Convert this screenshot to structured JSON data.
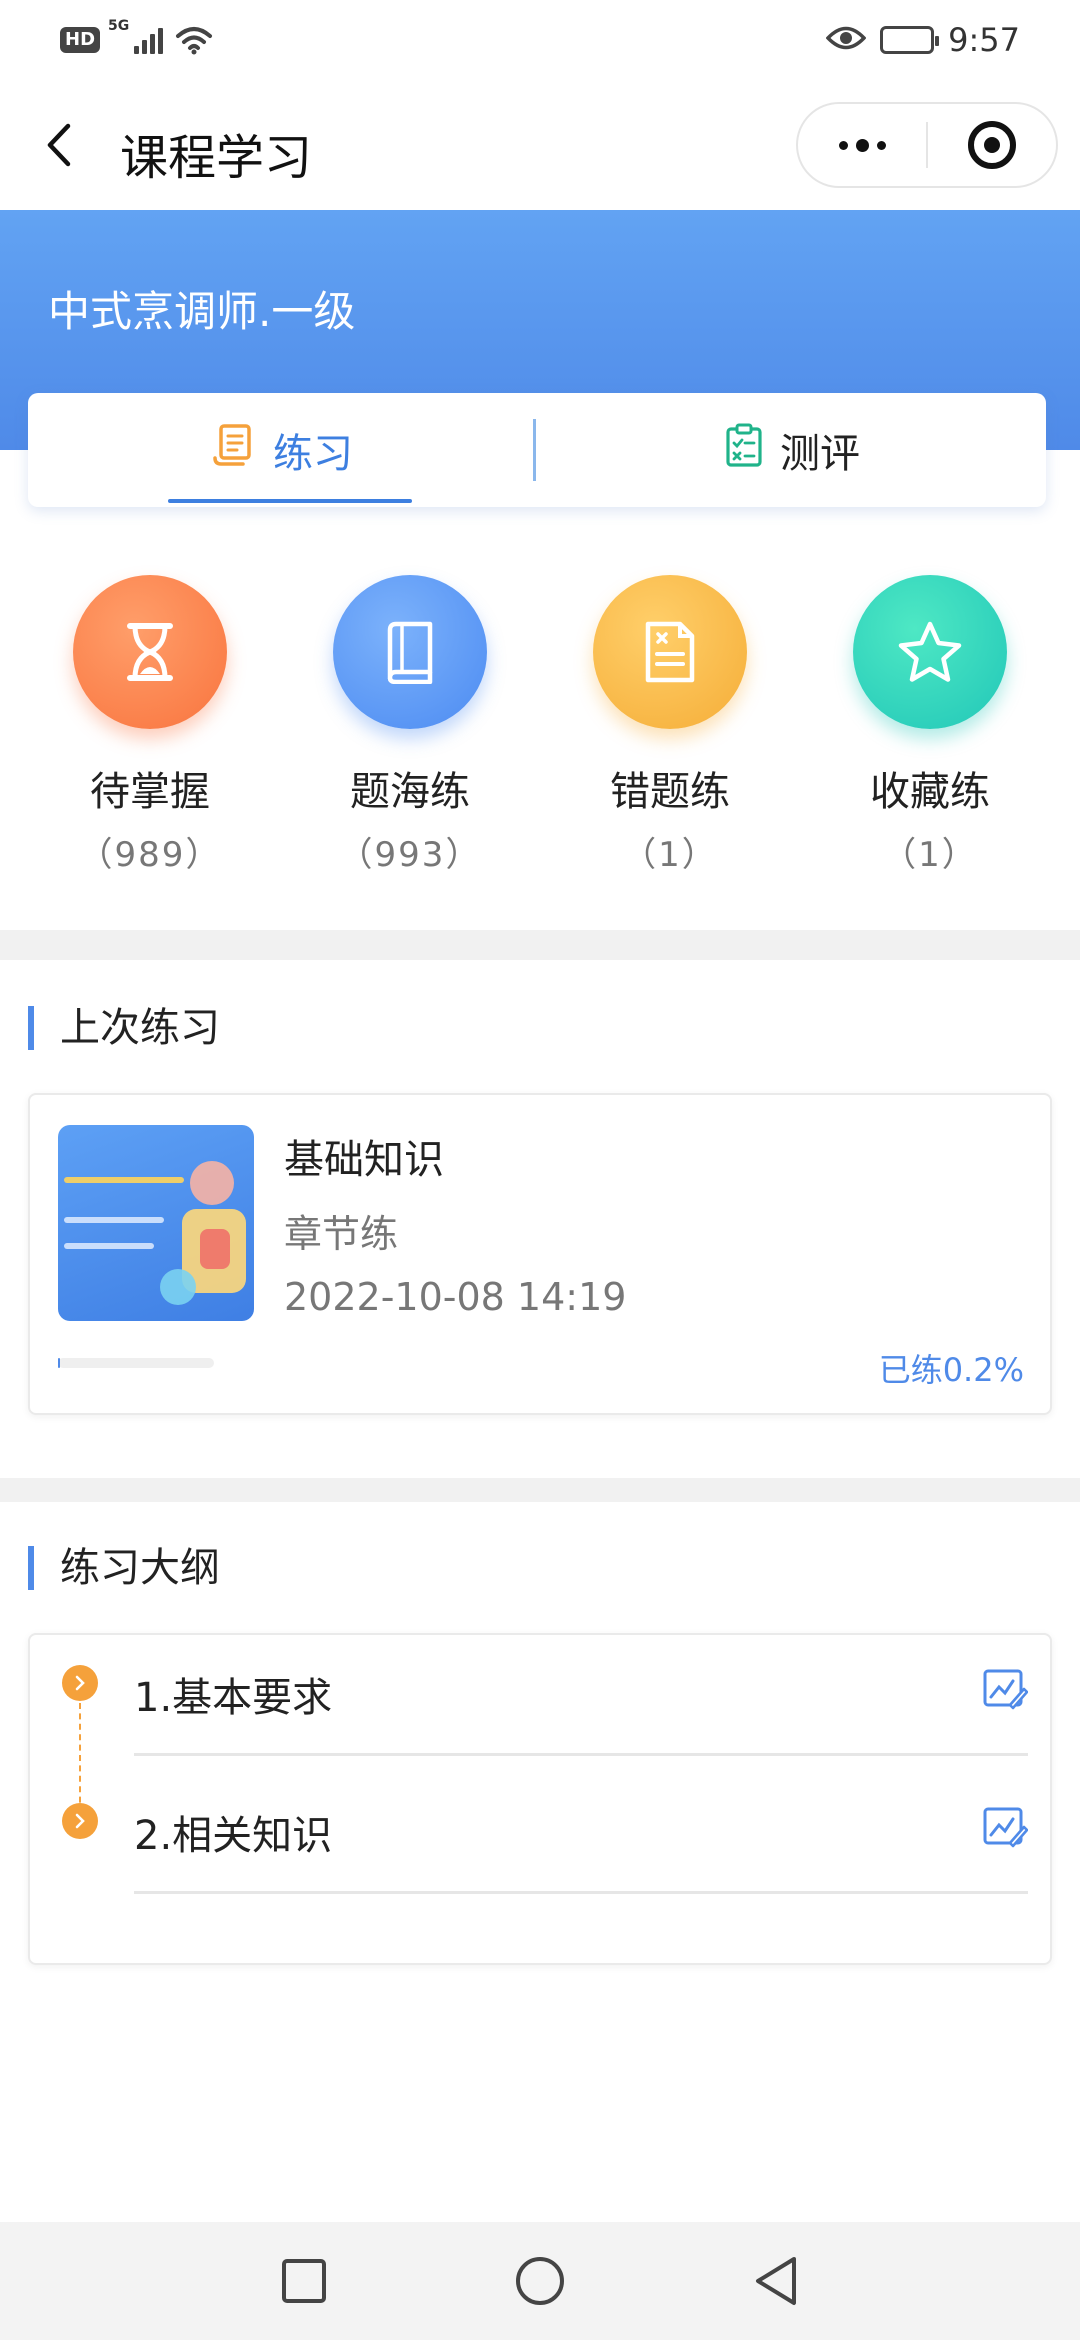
{
  "status_bar": {
    "hd": "HD",
    "network": "5G",
    "time": "9:57"
  },
  "nav": {
    "title": "课程学习",
    "icons": [
      "back-arrow-icon",
      "more-dots-icon",
      "close-target-icon"
    ]
  },
  "header": {
    "course_name": "中式烹调师.一级",
    "bg_color": "#4f8ae8"
  },
  "tabs": [
    {
      "label": "练习",
      "icon": "scroll-icon",
      "active": true
    },
    {
      "label": "测评",
      "icon": "clipboard-check-icon",
      "active": false
    }
  ],
  "categories": [
    {
      "label": "待掌握",
      "count": "（989）",
      "icon": "hourglass-icon",
      "color": "#f9743e"
    },
    {
      "label": "题海练",
      "count": "（993）",
      "icon": "book-icon",
      "color": "#4c8bf2"
    },
    {
      "label": "错题练",
      "count": "（1）",
      "icon": "wrong-doc-icon",
      "color": "#f5ad37"
    },
    {
      "label": "收藏练",
      "count": "（1）",
      "icon": "star-icon",
      "color": "#21c7b8"
    }
  ],
  "last_practice": {
    "section_title": "上次练习",
    "title": "基础知识",
    "subtitle": "章节练",
    "time": "2022-10-08 14:19",
    "progress_text": "已练0.2%",
    "progress_percent": 0.2
  },
  "outline": {
    "section_title": "练习大纲",
    "items": [
      {
        "label": "1.基本要求",
        "icon": "edit-chart-icon"
      },
      {
        "label": "2.相关知识",
        "icon": "edit-chart-icon"
      }
    ]
  },
  "system_nav": [
    "recent-apps-icon",
    "home-icon",
    "back-triangle-icon"
  ],
  "accent_color": "#3d7fe0"
}
